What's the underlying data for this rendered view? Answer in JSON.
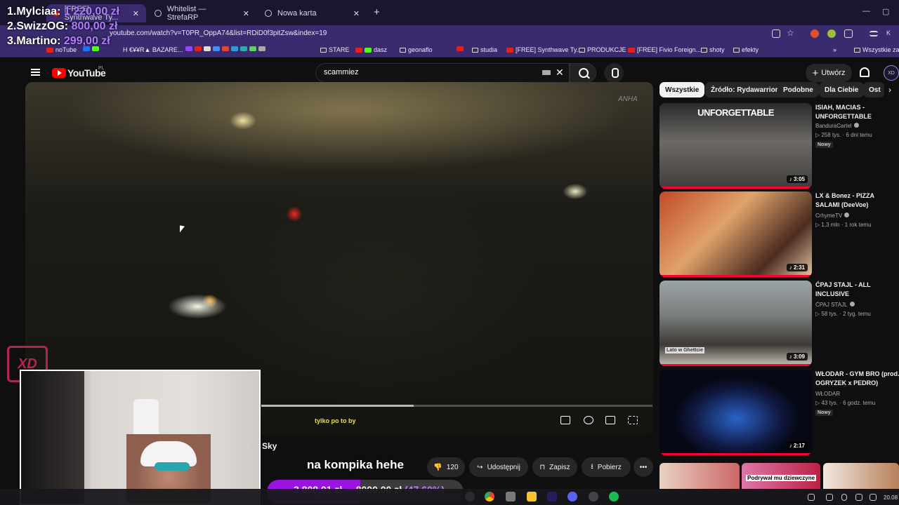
{
  "browser": {
    "tabs": [
      {
        "label": "[FREE] Synthwave Ty...",
        "active": true
      },
      {
        "label": "Whitelist — StrefaRP",
        "active": false
      },
      {
        "label": "Nowa karta",
        "active": false
      }
    ],
    "url": "youtube.com/watch?v=T0PR_OppA74&list=RDiD0f3pitZsw&index=19",
    "bookmarks": [
      "noTube",
      "H €¥¥R▲ BAZARE...",
      "STARE",
      "dasz",
      "geonaflo",
      "studia",
      "[FREE] Synthwave Ty...",
      "PRODUKCJE",
      "[FREE] Fivio Foreign...",
      "shoty",
      "efekty",
      "Wszystkie zak"
    ]
  },
  "youtube": {
    "logo_text": "YouTube",
    "region": "PL",
    "search_value": "scammiez",
    "create_label": "Utwórz",
    "avatar_text": "XD"
  },
  "player": {
    "watermark": "ANHA",
    "subtitle": "tylko po to by",
    "progress": 0.39
  },
  "below_video": {
    "title_fragment": "Sky",
    "dislike_count": "120",
    "share_label": "Udostępnij",
    "save_label": "Zapisz",
    "download_label": "Pobierz",
    "more_label": "•••"
  },
  "sidebar": {
    "chips": [
      "Wszystkie",
      "Źródło: Rydawarrior",
      "Podobne",
      "Dla Ciebie",
      "Ost"
    ],
    "videos": [
      {
        "title": "ISIAH, MACIAS - UNFORGETTABLE",
        "channel": "BanduraCartel",
        "views": "258 tys.",
        "age": "6 dni temu",
        "duration": "3:05",
        "badge": "Nowy",
        "thumb_text": "UNFORGETTABLE"
      },
      {
        "title": "LX & Bonez - PIZZA SALAMI (DeeVoe)",
        "channel": "CrhymeTV",
        "views": "1,3 mln",
        "age": "1 rok temu",
        "duration": "2:31",
        "badge": "",
        "thumb_text": ""
      },
      {
        "title": "ĆPAJ STAJL - ALL INCLUSIVE",
        "channel": "ĆPAJ STAJL",
        "views": "58 tys.",
        "age": "2 tyg. temu",
        "duration": "3:09",
        "badge": "",
        "thumb_text": "Lato w Ghettcie"
      },
      {
        "title": "WŁODAR - GYM BRO (prod. OGRYZEK x PEDRO)",
        "channel": "WŁODAR",
        "views": "43 tys.",
        "age": "6 godz. temu",
        "duration": "2:17",
        "badge": "Nowy",
        "thumb_text": ""
      }
    ],
    "partial_thumb_text": "Podrywał mu dziewczyne"
  },
  "stream_overlay": {
    "leaderboard": [
      {
        "rank_name": "1.Mylciaa:",
        "amount": "1 220,00 zł"
      },
      {
        "rank_name": "2.SwizzOG:",
        "amount": "800,00 zł"
      },
      {
        "rank_name": "3.Martino:",
        "amount": "299,00 zł"
      }
    ],
    "badge": "XD",
    "chat_message": "na kompika hehe",
    "goal": {
      "current": "3 808,01 zł",
      "target": "8000,00 zł",
      "percent_text": "(47.60%)",
      "fraction": 0.476
    }
  },
  "taskbar": {
    "clock": "20.08"
  },
  "colors": {
    "accent": "#9b13e0",
    "youtube_red": "#ff0000",
    "browser_purple": "#3a2b6e"
  }
}
